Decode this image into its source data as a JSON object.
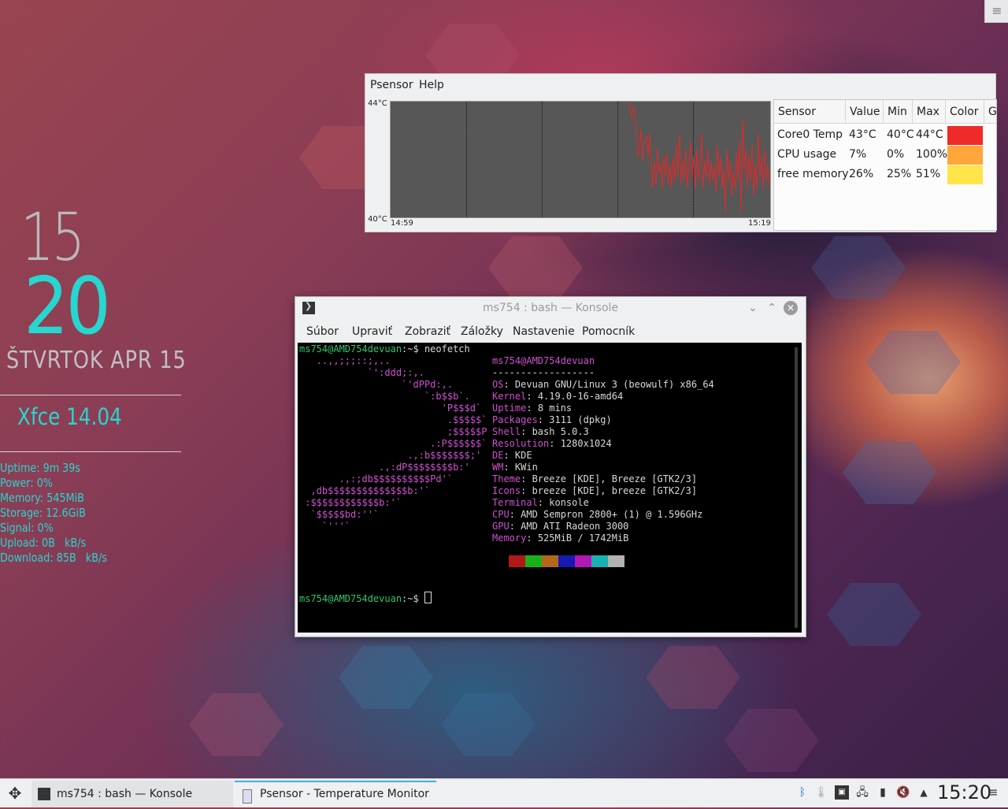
{
  "widget": {
    "hour": "15",
    "minute": "20",
    "date": "Štvrtok apr 15",
    "distro": "Xfce 14.04",
    "stats": [
      {
        "label": "Uptime:",
        "value": "9m 39s"
      },
      {
        "label": "Power:",
        "value": "0%"
      },
      {
        "label": "Memory:",
        "value": "545MiB"
      },
      {
        "label": "Storage:",
        "value": "12.6GiB"
      },
      {
        "label": "Signal:",
        "value": "0%"
      },
      {
        "label": "Upload:",
        "value": "0B   kB/s"
      },
      {
        "label": "Download:",
        "value": "85B   kB/s"
      }
    ]
  },
  "psensor": {
    "menu": [
      "Psensor",
      "Help"
    ],
    "y_max": "44°C",
    "y_min": "40°C",
    "x_start": "14:59",
    "x_end": "15:19",
    "headers": [
      "Sensor",
      "Value",
      "Min",
      "Max",
      "Color",
      "G"
    ],
    "rows": [
      {
        "sensor": "Core0 Temp",
        "value": "43°C",
        "min": "40°C",
        "max": "44°C",
        "color": "#ee2a2a"
      },
      {
        "sensor": "CPU usage",
        "value": "7%",
        "min": "0%",
        "max": "100%",
        "color": "#ffa63a"
      },
      {
        "sensor": "free memory",
        "value": "26%",
        "min": "25%",
        "max": "51%",
        "color": "#ffe44a"
      }
    ]
  },
  "konsole": {
    "title": "ms754 : bash — Konsole",
    "menu": [
      "Súbor",
      "Upraviť",
      "Zobraziť",
      "Záložky",
      "Nastavenie",
      "Pomocník"
    ],
    "prompt_user": "ms754@AMD754devuan",
    "prompt_tail": ":~$ ",
    "command": "neofetch",
    "logo": [
      "   ..,,;;;::;,..",
      "            `':ddd;:,.",
      "                  `'dPPd:,.",
      "                      `:b$$b`.",
      "                         'P$$$d`",
      "                          .$$$$$`",
      "                          ;$$$$$P",
      "                       .:P$$$$$$`",
      "                   .,:b$$$$$$$;'",
      "              .,:dP$$$$$$$$b:'",
      "       .,:;db$$$$$$$$$$Pd'`",
      "  ,db$$$$$$$$$$$$$$b:'`",
      " :$$$$$$$$$$$$b:'`",
      "  `$$$$$bd:''`",
      "    `'''`"
    ],
    "host": "ms754@AMD754devuan",
    "separator": "------------------",
    "info": [
      {
        "k": "OS",
        "v": "Devuan GNU/Linux 3 (beowulf) x86_64"
      },
      {
        "k": "Kernel",
        "v": "4.19.0-16-amd64"
      },
      {
        "k": "Uptime",
        "v": "8 mins"
      },
      {
        "k": "Packages",
        "v": "3111 (dpkg)"
      },
      {
        "k": "Shell",
        "v": "bash 5.0.3"
      },
      {
        "k": "Resolution",
        "v": "1280x1024"
      },
      {
        "k": "DE",
        "v": "KDE"
      },
      {
        "k": "WM",
        "v": "KWin"
      },
      {
        "k": "Theme",
        "v": "Breeze [KDE], Breeze [GTK2/3]"
      },
      {
        "k": "Icons",
        "v": "breeze [KDE], breeze [GTK2/3]"
      },
      {
        "k": "Terminal",
        "v": "konsole"
      },
      {
        "k": "CPU",
        "v": "AMD Sempron 2800+ (1) @ 1.596GHz"
      },
      {
        "k": "GPU",
        "v": "AMD ATI Radeon 3000"
      },
      {
        "k": "Memory",
        "v": "525MiB / 1742MiB"
      }
    ],
    "palette": [
      "#b21818",
      "#18b218",
      "#b26818",
      "#1818b2",
      "#b218b2",
      "#18b2b2",
      "#b2b2b2"
    ]
  },
  "taskbar": {
    "tasks": [
      {
        "label": "ms754 : bash — Konsole",
        "active": false
      },
      {
        "label": "Psensor - Temperature Monitor",
        "active": true
      }
    ],
    "clock": "15:20"
  }
}
